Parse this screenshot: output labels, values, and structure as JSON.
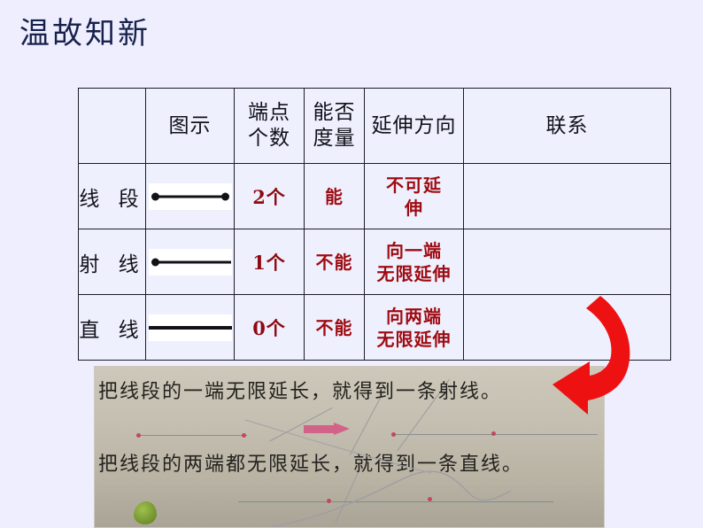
{
  "slide": {
    "title": "温故知新",
    "background_color": "#eeeeff",
    "title_color": "#17214b",
    "accent_red": "#9e0b12",
    "arrow_color": "#ee1111"
  },
  "table": {
    "headers": {
      "corner": "",
      "figure": "图示",
      "endpoints_line1": "端点",
      "endpoints_line2": "个数",
      "measurable_line1": "能否",
      "measurable_line2": "度量",
      "direction": "延伸方向",
      "relation": "联系"
    },
    "rows": [
      {
        "name": "线 段",
        "figure_type": "segment-with-two-endpoints",
        "endpoints": "2个",
        "measurable": "能",
        "direction_line1": "不可延",
        "direction_line2": "伸",
        "relation": ""
      },
      {
        "name": "射 线",
        "figure_type": "ray-with-one-endpoint",
        "endpoints": "1个",
        "measurable": "不能",
        "direction_line1": "向一端",
        "direction_line2": "无限延伸",
        "relation": ""
      },
      {
        "name": "直 线",
        "figure_type": "straight-line-no-endpoints",
        "endpoints": "0个",
        "measurable": "不能",
        "direction_line1": "向两端",
        "direction_line2": "无限延伸",
        "relation": ""
      }
    ]
  },
  "photo": {
    "caption_line1": "把线段的一端无限延长，就得到一条射线。",
    "caption_line2": "把线段的两端都无限延长，就得到一条直线。",
    "paper_color": "#c4bfb0",
    "dot_color": "#c2485f",
    "pink_arrow_color": "#d26287"
  }
}
